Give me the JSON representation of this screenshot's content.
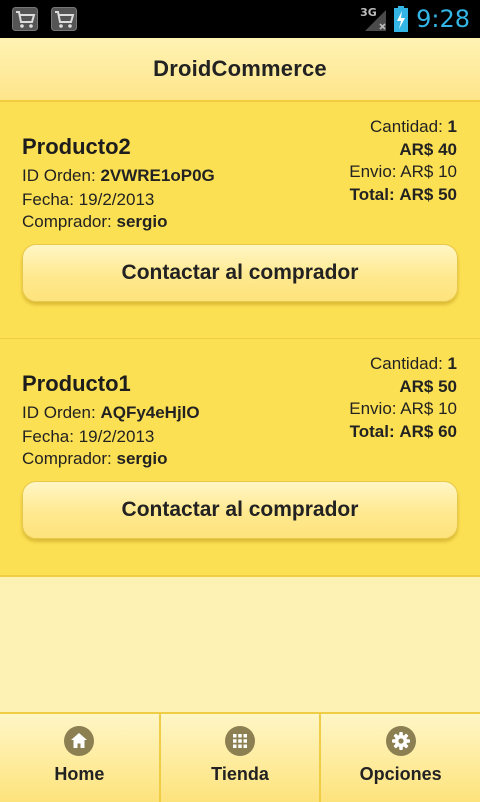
{
  "status_bar": {
    "network": "3G",
    "time": "9:28"
  },
  "header": {
    "title": "DroidCommerce"
  },
  "orders": [
    {
      "product": "Producto2",
      "order_id_label": "ID Orden:",
      "order_id": "2VWRE1oP0G",
      "date_label": "Fecha:",
      "date": "19/2/2013",
      "buyer_label": "Comprador:",
      "buyer": "sergio",
      "quantity_label": "Cantidad:",
      "quantity": "1",
      "price": "AR$ 40",
      "shipping_label": "Envio:",
      "shipping": "AR$ 10",
      "total_label": "Total:",
      "total": "AR$ 50",
      "contact_label": "Contactar al comprador"
    },
    {
      "product": "Producto1",
      "order_id_label": "ID Orden:",
      "order_id": "AQFy4eHjlO",
      "date_label": "Fecha:",
      "date": "19/2/2013",
      "buyer_label": "Comprador:",
      "buyer": "sergio",
      "quantity_label": "Cantidad:",
      "quantity": "1",
      "price": "AR$ 50",
      "shipping_label": "Envio:",
      "shipping": "AR$ 10",
      "total_label": "Total:",
      "total": "AR$ 60",
      "contact_label": "Contactar al comprador"
    }
  ],
  "bottom_nav": [
    {
      "label": "Home",
      "icon": "home-icon"
    },
    {
      "label": "Tienda",
      "icon": "grid-icon"
    },
    {
      "label": "Opciones",
      "icon": "gear-icon"
    }
  ],
  "colors": {
    "status_accent": "#33b5e5",
    "card_background": "#fce053",
    "page_background": "#fdf2b4",
    "icon_circle": "#8c7f52"
  }
}
